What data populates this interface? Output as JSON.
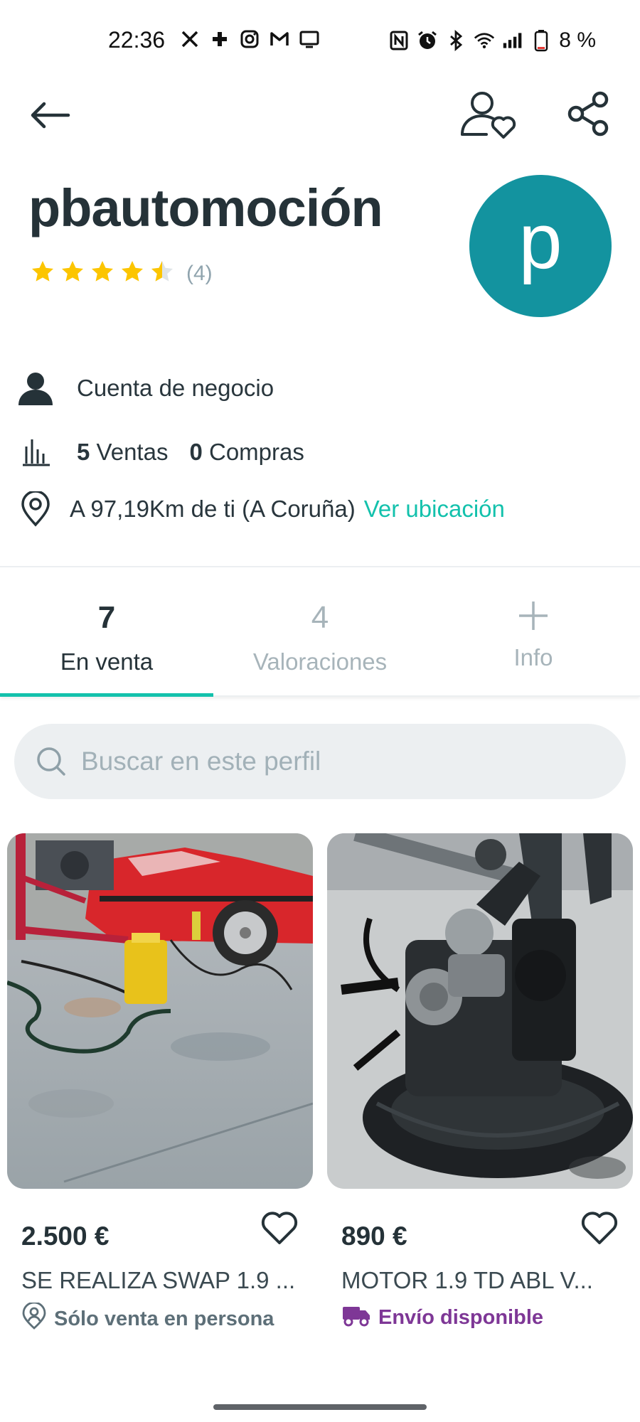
{
  "status_bar": {
    "time": "22:36",
    "battery": "8 %",
    "left_icons": [
      "x-icon",
      "medical-icon",
      "instagram-icon",
      "gmail-icon",
      "tv-icon"
    ],
    "right_icons": [
      "nfc-icon",
      "alarm-icon",
      "bluetooth-icon",
      "wifi-icon",
      "signal-icon",
      "battery-icon"
    ]
  },
  "header": {
    "back_icon": "arrow-left-icon",
    "follow_icon": "user-heart-icon",
    "share_icon": "share-icon"
  },
  "profile": {
    "name": "pbautomoción",
    "rating_stars": 4.5,
    "rating_count": "(4)",
    "avatar_letter": "p",
    "avatar_color": "#13939f"
  },
  "info": {
    "account_type": "Cuenta de negocio",
    "sales_count": "5",
    "sales_label": "Ventas",
    "purchases_count": "0",
    "purchases_label": "Compras",
    "location_text": "A 97,19Km de ti (A Coruña)",
    "location_link": "Ver ubicación"
  },
  "tabs": [
    {
      "count": "7",
      "label": "En venta",
      "active": true
    },
    {
      "count": "4",
      "label": "Valoraciones",
      "active": false
    },
    {
      "count": "",
      "label": "Info",
      "active": false
    }
  ],
  "search": {
    "placeholder": "Buscar en este perfil"
  },
  "listings": [
    {
      "price": "2.500 €",
      "title": "SE REALIZA SWAP 1.9 ...",
      "badge": "Sólo venta en persona",
      "badge_icon": "person-pin-icon"
    },
    {
      "price": "890 €",
      "title": "MOTOR 1.9 TD ABL V...",
      "badge": "Envío disponible",
      "badge_icon": "truck-icon"
    }
  ],
  "colors": {
    "accent": "#13c1ac",
    "star": "#fcc500",
    "shipping": "#7e3796"
  }
}
